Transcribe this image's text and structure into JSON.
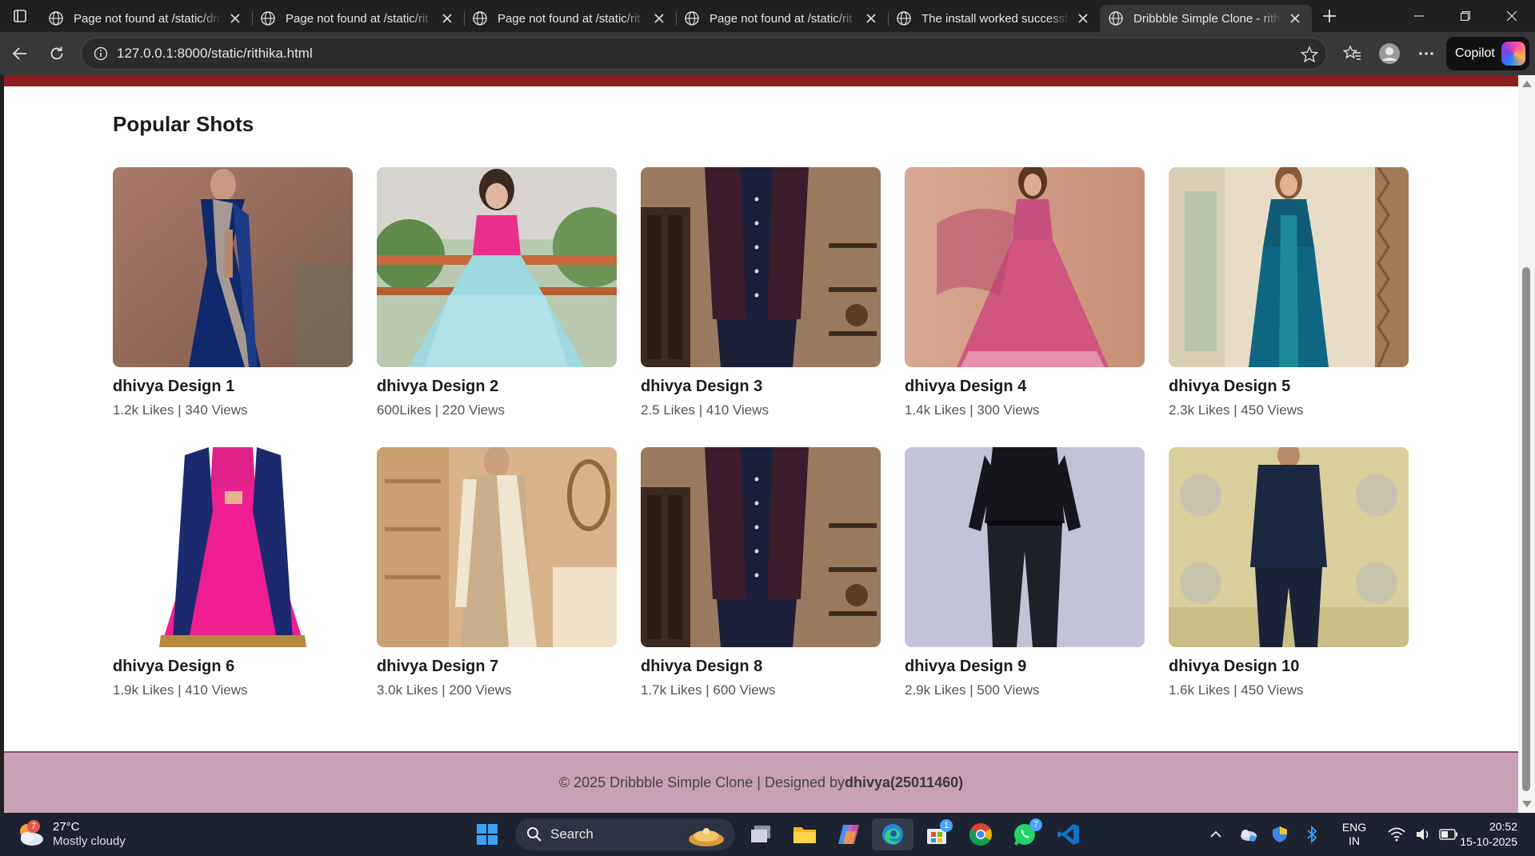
{
  "browser": {
    "tabs": [
      {
        "title": "Page not found at /static/dri",
        "active": false
      },
      {
        "title": "Page not found at /static/rit",
        "active": false
      },
      {
        "title": "Page not found at /static/rit",
        "active": false
      },
      {
        "title": "Page not found at /static/rit",
        "active": false
      },
      {
        "title": "The install worked successfu",
        "active": false
      },
      {
        "title": "Dribbble Simple Clone - rith",
        "active": true
      }
    ],
    "url": "127.0.0.1:8000/static/rithika.html",
    "copilot_label": "Copilot"
  },
  "page": {
    "section_title": "Popular Shots",
    "shots": [
      {
        "name": "dhivya Design 1",
        "stats": "1.2k Likes | 340 Views",
        "image": "navy-saree-photo"
      },
      {
        "name": "dhivya Design 2",
        "stats": "600Likes | 220 Views",
        "image": "girl-tulle-gown-photo"
      },
      {
        "name": "dhivya Design 3",
        "stats": "2.5 Likes | 410 Views",
        "image": "indo-western-jacket-photo"
      },
      {
        "name": "dhivya Design 4",
        "stats": "1.4k Likes | 300 Views",
        "image": "pink-anarkali-photo"
      },
      {
        "name": "dhivya Design 5",
        "stats": "2.3k Likes | 450 Views",
        "image": "teal-jacket-dress-photo"
      },
      {
        "name": "dhivya Design 6",
        "stats": "1.9k Likes | 410 Views",
        "image": "pink-anarkali-dupatta-photo"
      },
      {
        "name": "dhivya Design 7",
        "stats": "3.0k Likes | 200 Views",
        "image": "sherwani-shawl-photo"
      },
      {
        "name": "dhivya Design 8",
        "stats": "1.7k Likes | 600 Views",
        "image": "indo-western-jacket-photo"
      },
      {
        "name": "dhivya Design 9",
        "stats": "2.9k Likes | 500 Views",
        "image": "black-shirt-trousers-photo"
      },
      {
        "name": "dhivya Design 10",
        "stats": "1.6k Likes | 450 Views",
        "image": "navy-bandhgala-photo"
      }
    ],
    "footer": {
      "text": "© 2025 Dribbble Simple Clone | Designed by ",
      "author": "dhivya(25011460)"
    }
  },
  "taskbar": {
    "weather": {
      "temp": "27°C",
      "condition": "Mostly cloudy",
      "badge": "7"
    },
    "search_label": "Search",
    "store_badge": "1",
    "whatsapp_badge": "7",
    "language": {
      "line1": "ENG",
      "line2": "IN"
    },
    "time": "20:52",
    "date": "15-10-2025"
  },
  "colors": {
    "header_band": "#8b1c1f",
    "footer_bg": "#c9a1b6",
    "taskbar_bg": "#1d2230"
  }
}
